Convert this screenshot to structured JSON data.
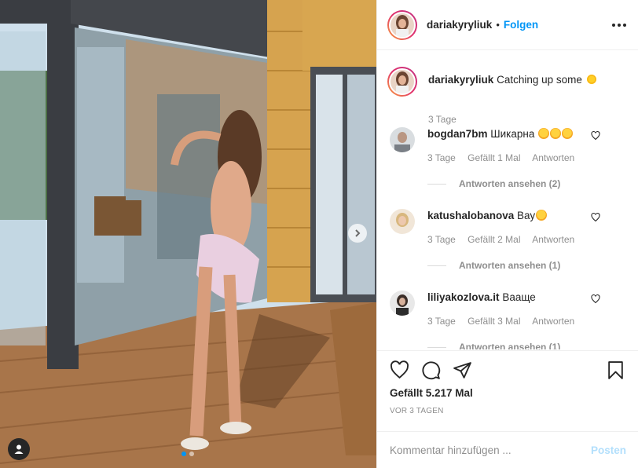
{
  "colors": {
    "accent": "#0095f6",
    "muted": "#8e8e8e",
    "post_disabled": "#b2dffc"
  },
  "post": {
    "username": "dariakyryliuk",
    "follow_label": "Folgen",
    "more_icon": "more-horizontal-icon",
    "caption": {
      "username": "dariakyryliuk",
      "text": "Catching up some",
      "emoji": "sun",
      "time": "3 Tage"
    },
    "carousel": {
      "slide": 1,
      "slides": 2,
      "next_icon": "chevron-right-icon",
      "tag_icon": "user-tag-icon"
    }
  },
  "comments": [
    {
      "username": "bogdan7bm",
      "text": "Шикарна",
      "emoji_count": 3,
      "time": "3 Tage",
      "likes": "Gefällt 1 Mal",
      "reply": "Antworten",
      "view_replies": "Antworten ansehen (2)"
    },
    {
      "username": "katushalobanova",
      "text": "Вау",
      "emoji_count": 1,
      "time": "3 Tage",
      "likes": "Gefällt 2 Mal",
      "reply": "Antworten",
      "view_replies": "Antworten ansehen (1)"
    },
    {
      "username": "liliyakozlova.it",
      "text": "Вааще",
      "emoji_count": 0,
      "time": "3 Tage",
      "likes": "Gefällt 3 Mal",
      "reply": "Antworten",
      "view_replies": "Antworten ansehen (1)"
    }
  ],
  "actions": {
    "icons": [
      "heart-icon",
      "comment-icon",
      "share-icon",
      "bookmark-icon"
    ],
    "likes": "Gefällt 5.217 Mal",
    "date": "VOR 3 TAGEN"
  },
  "composer": {
    "placeholder": "Kommentar hinzufügen ...",
    "post_label": "Posten"
  }
}
